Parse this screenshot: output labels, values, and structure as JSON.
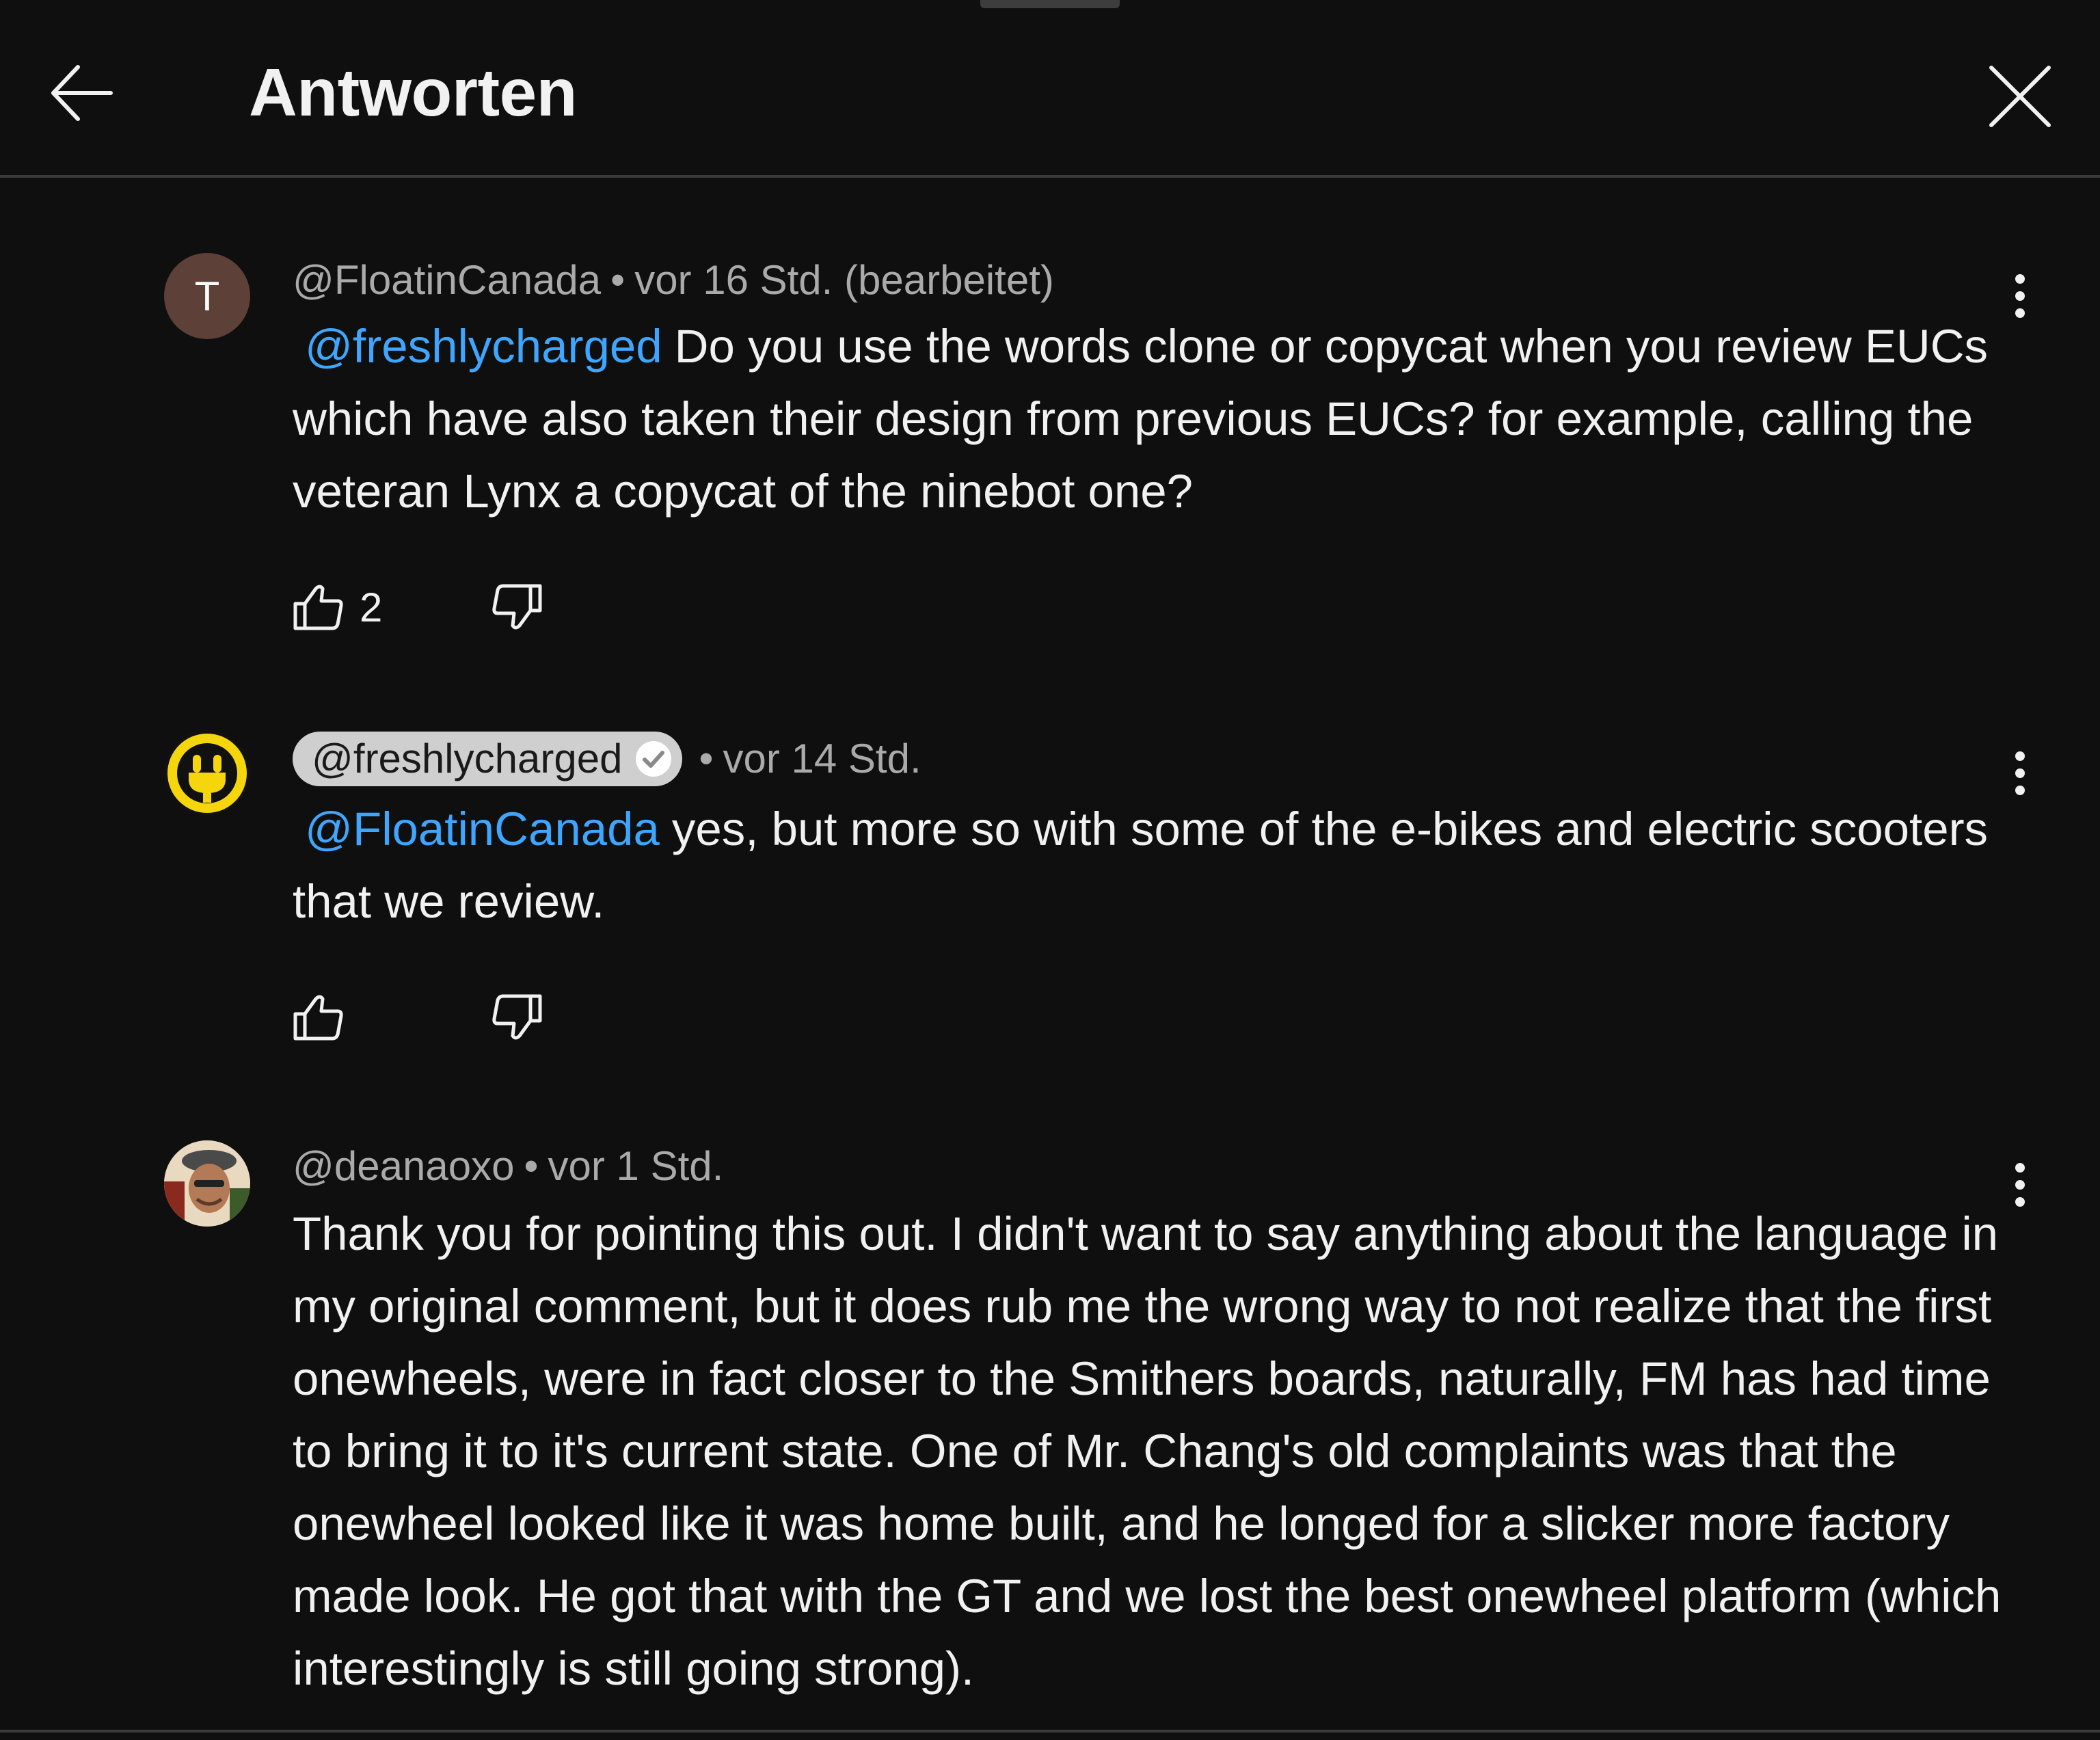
{
  "header": {
    "title": "Antworten",
    "back_icon": "arrow-left-icon",
    "close_icon": "close-icon"
  },
  "colors": {
    "background": "#0f0f0f",
    "text": "#f1f1f1",
    "secondary_text": "#aaaaaa",
    "mention": "#3ea6ff",
    "avatar_t": "#5d4037",
    "owner_pill": "#cfcfcf"
  },
  "comments": [
    {
      "avatar_letter": "T",
      "author": "@FloatinCanada",
      "separator": "•",
      "time": "vor 16 Std. (bearbeitet)",
      "mention": "@freshlycharged",
      "text": "Do you use the words clone or copycat when you review EUCs which have also taken their design from previous EUCs? for example, calling the veteran Lynx a copycat of the ninebot one?",
      "likes": "2"
    },
    {
      "author": "@freshlycharged",
      "separator": "•",
      "time": "vor 14 Std.",
      "mention": "@FloatinCanada",
      "text": "yes, but more so with some of the e-bikes and electric scooters that we review.",
      "likes": ""
    },
    {
      "author": "@deanaoxo",
      "separator": "•",
      "time": "vor 1 Std.",
      "text": "Thank you for pointing this out. I didn't want to say anything about the language in my original comment, but it does rub me the wrong way to not realize that the first onewheels, were in fact closer to the Smithers boards, naturally, FM has had time to bring it to it's current state. One of Mr. Chang's old complaints was that the onewheel looked like it was home built, and he longed for a slicker more factory made look. He got that with the GT and we lost the best onewheel platform (which interestingly is still going strong)."
    }
  ]
}
